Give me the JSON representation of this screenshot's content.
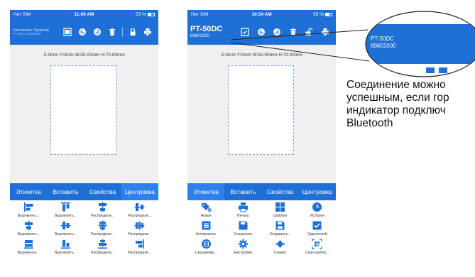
{
  "phone_left": {
    "status": {
      "carrier": "Нет SIM",
      "time": "11:09 AM",
      "battery": "53 %"
    },
    "device": {
      "name": "Отключить Принтер",
      "sub": "PT-50DC 80601000"
    },
    "dims": "X:0mm  Y:0mm   W:50.00mm   H:70.00mm",
    "tabs": [
      "Этикетка",
      "Вставить",
      "Свойства",
      "Центровка"
    ],
    "tools": [
      {
        "label": "Выровнять...",
        "icon": "align-left-icon"
      },
      {
        "label": "Выровнять...",
        "icon": "align-top-icon"
      },
      {
        "label": "Распредели...",
        "icon": "distribute-vertical-icon"
      },
      {
        "label": "Распредели...",
        "icon": "distribute-horizontal-icon"
      },
      {
        "label": "Выровнять...",
        "icon": "align-center-horizontal-icon"
      },
      {
        "label": "Выровнять...",
        "icon": "align-center-vertical-icon"
      },
      {
        "label": "Распредели...",
        "icon": "distribute-center-icon"
      },
      {
        "label": "Распредели...",
        "icon": "distribute-middle-icon"
      },
      {
        "label": "Выровнять...",
        "icon": "align-bottom-icon"
      },
      {
        "label": "Выровнять...",
        "icon": "align-bottom-bars-icon"
      },
      {
        "label": "Распредели...",
        "icon": "distribute-bottom-icon"
      },
      {
        "label": "Распредели...",
        "icon": "align-right-icon"
      }
    ]
  },
  "phone_right": {
    "status": {
      "carrier": "Нет SIM",
      "time": "10:54 AM",
      "battery": "59 %"
    },
    "device": {
      "name": "PT-50DC",
      "sub": "80601000"
    },
    "dims": "X:0mm  Y:0mm   W:50.00mm   H:70.00mm",
    "tabs": [
      "Этикетка",
      "Вставить",
      "Свойства",
      "Центровка"
    ],
    "tools": [
      {
        "label": "Новая",
        "icon": "tag-plus-icon"
      },
      {
        "label": "Печать",
        "icon": "printer-icon"
      },
      {
        "label": "Шаблон",
        "icon": "template-icon"
      },
      {
        "label": "История",
        "icon": "clock-icon"
      },
      {
        "label": "Копировать",
        "icon": "copy-icon"
      },
      {
        "label": "Сохранить",
        "icon": "save-icon"
      },
      {
        "label": "Сохранить...",
        "icon": "save-as-icon"
      },
      {
        "label": "Одиночный",
        "icon": "checkbox-icon"
      },
      {
        "label": "Сканирова...",
        "icon": "barcode-scan-icon"
      },
      {
        "label": "Настройки",
        "icon": "gear-icon"
      },
      {
        "label": "Сервис",
        "icon": "service-icon"
      },
      {
        "label": "Скан шабло...",
        "icon": "scan-template-icon"
      }
    ]
  },
  "callout": {
    "device_name": "PT-50DC",
    "device_id": "80601000"
  },
  "caption": {
    "line1": "Соединение можно",
    "line2": "успешным, если гор",
    "line3": "индикатор подключ",
    "line4": "Bluetooth"
  },
  "colors": {
    "header_blue": "#1e6fd6",
    "tab_active_blue": "#2b82ee",
    "icon_blue": "#1e6fd6"
  }
}
